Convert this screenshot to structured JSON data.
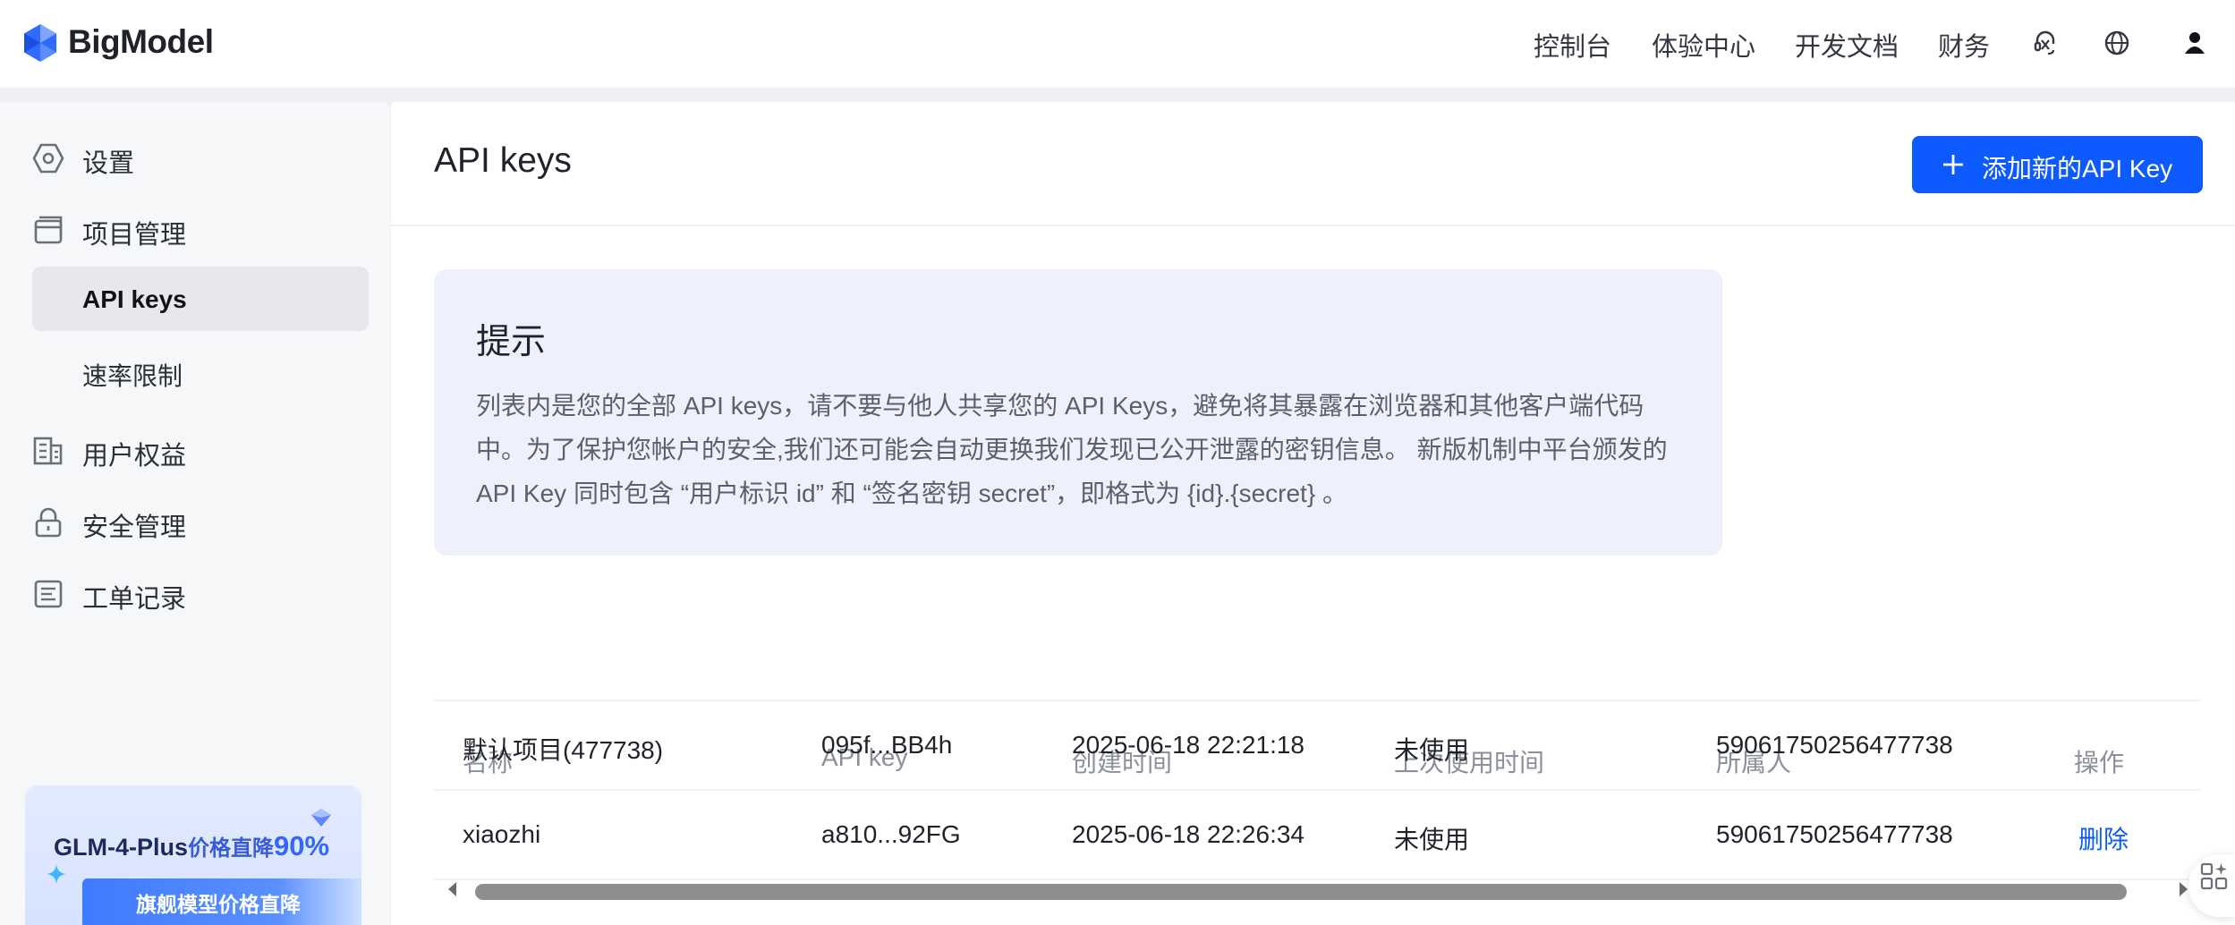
{
  "header": {
    "brand": "BigModel",
    "nav": [
      "控制台",
      "体验中心",
      "开发文档",
      "财务"
    ]
  },
  "sidebar": {
    "items": [
      {
        "label": "设置",
        "icon": "settings-hexagon-icon"
      },
      {
        "label": "项目管理",
        "icon": "folder-icon"
      },
      {
        "label": "API keys",
        "sub": true,
        "active": true
      },
      {
        "label": "速率限制",
        "sub": true
      },
      {
        "label": "用户权益",
        "icon": "building-icon"
      },
      {
        "label": "安全管理",
        "icon": "lock-icon"
      },
      {
        "label": "工单记录",
        "icon": "ticket-icon"
      }
    ],
    "promo": {
      "title_main": "GLM-4-Plus",
      "title_mid": "价格直降",
      "title_pct": "90%",
      "subtitle": "旗舰模型价格直降"
    }
  },
  "main": {
    "title": "API keys",
    "add_button": "添加新的API Key",
    "tip": {
      "title": "提示",
      "body": "列表内是您的全部 API keys，请不要与他人共享您的 API Keys，避免将其暴露在浏览器和其他客户端代码中。为了保护您帐户的安全,我们还可能会自动更换我们发现已公开泄露的密钥信息。 新版机制中平台颁发的 API Key 同时包含 “用户标识 id” 和 “签名密钥 secret”，即格式为 {id}.{secret} 。"
    },
    "table": {
      "headers": [
        "名称",
        "API key",
        "创建时间",
        "上次使用时间",
        "所属人",
        "操作"
      ],
      "rows": [
        {
          "name": "默认项目(477738)",
          "key": "095f...BB4h",
          "created": "2025-06-18 22:21:18",
          "last_used": "未使用",
          "owner": "59061750256477738",
          "action": ""
        },
        {
          "name": "xiaozhi",
          "key": "a810...92FG",
          "created": "2025-06-18 22:26:34",
          "last_used": "未使用",
          "owner": "59061750256477738",
          "action": "删除"
        }
      ]
    }
  },
  "colors": {
    "primary": "#0d5bff",
    "tip_bg": "#eef1fb",
    "sidebar_bg": "#f6f7f9",
    "active_bg": "#e7e8eb"
  }
}
